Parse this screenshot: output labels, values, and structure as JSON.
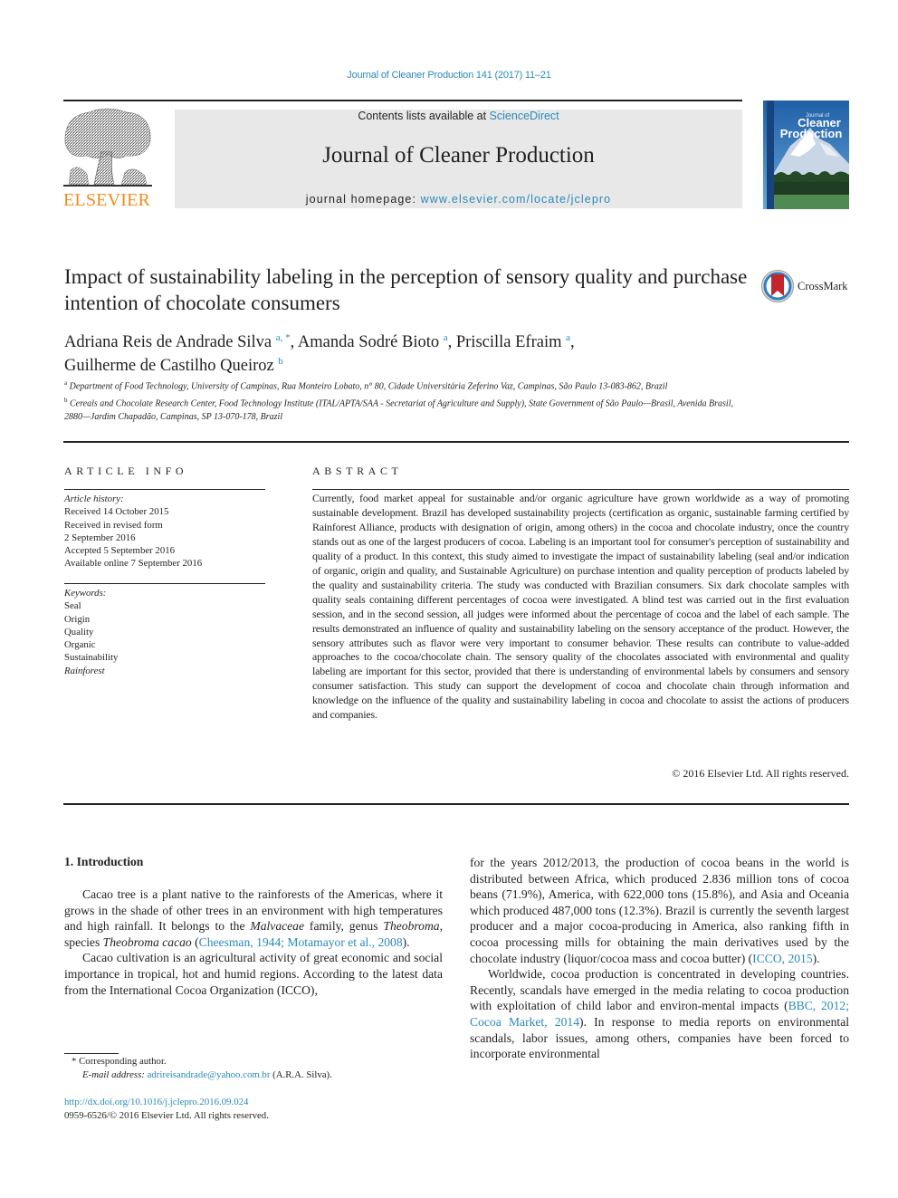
{
  "header": {
    "journal_ref": "Journal of Cleaner Production 141 (2017) 11–21",
    "contents_prefix": "Contents lists available at ",
    "contents_link": "ScienceDirect",
    "journal_title": "Journal of Cleaner Production",
    "homepage_prefix": "journal homepage: ",
    "homepage_link": "www.elsevier.com/locate/jclepro",
    "publisher_logo_text": "ELSEVIER",
    "cover": {
      "small_title": "Journal of",
      "line1": "Cleaner",
      "line2": "Production"
    },
    "colors": {
      "link": "#2a8ab8",
      "elsevier_orange": "#f28b1e",
      "masthead_bg": "#e8e8e8"
    }
  },
  "article": {
    "title": "Impact of sustainability labeling in the perception of sensory quality and purchase intention of chocolate consumers",
    "crossmark_label": "CrossMark",
    "authors": [
      {
        "name": "Adriana Reis de Andrade Silva",
        "sup": "a, *",
        "sep": ", "
      },
      {
        "name": "Amanda Sodré Bioto",
        "sup": "a",
        "sep": ", "
      },
      {
        "name": "Priscilla Efraim",
        "sup": "a",
        "sep": ","
      },
      {
        "name": "Guilherme de Castilho Queiroz",
        "sup": "b",
        "sep": ""
      }
    ],
    "affiliations": [
      {
        "mark": "a",
        "text": "Department of Food Technology, University of Campinas, Rua Monteiro Lobato, n° 80, Cidade Universitária Zeferino Vaz, Campinas, São Paulo 13-083-862, Brazil"
      },
      {
        "mark": "b",
        "text": "Cereals and Chocolate Research Center, Food Technology Institute (ITAL/APTA/SAA - Secretariat of Agriculture and Supply), State Government of São Paulo—Brasil, Avenida Brasil, 2880—Jardim Chapadão, Campinas, SP 13-070-178, Brazil"
      }
    ]
  },
  "article_info": {
    "heading": "ARTICLE INFO",
    "history_label": "Article history:",
    "history": [
      "Received 14 October 2015",
      "Received in revised form",
      "2 September 2016",
      "Accepted 5 September 2016",
      "Available online 7 September 2016"
    ],
    "keywords_label": "Keywords:",
    "keywords": [
      "Seal",
      "Origin",
      "Quality",
      "Organic",
      "Sustainability",
      "Rainforest"
    ]
  },
  "abstract": {
    "heading": "ABSTRACT",
    "text": "Currently, food market appeal for sustainable and/or organic agriculture have grown worldwide as a way of promoting sustainable development. Brazil has developed sustainability projects (certification as organic, sustainable farming certified by Rainforest Alliance, products with designation of origin, among others) in the cocoa and chocolate industry, once the country stands out as one of the largest producers of cocoa. Labeling is an important tool for consumer's perception of sustainability and quality of a product. In this context, this study aimed to investigate the impact of sustainability labeling (seal and/or indication of organic, origin and quality, and Sustainable Agriculture) on purchase intention and quality perception of products labeled by the quality and sustainability criteria. The study was conducted with Brazilian consumers. Six dark chocolate samples with quality seals containing different percentages of cocoa were investigated. A blind test was carried out in the first evaluation session, and in the second session, all judges were informed about the percentage of cocoa and the label of each sample. The results demonstrated an influence of quality and sustainability labeling on the sensory acceptance of the product. However, the sensory attributes such as flavor were very important to consumer behavior. These results can contribute to value-added approaches to the cocoa/chocolate chain. The sensory quality of the chocolates associated with environmental and quality labeling are important for this sector, provided that there is understanding of environmental labels by consumers and sensory consumer satisfaction. This study can support the development of cocoa and chocolate chain through information and knowledge on the influence of the quality and sustainability labeling in cocoa and chocolate to assist the actions of producers and companies.",
    "copyright": "© 2016 Elsevier Ltd. All rights reserved."
  },
  "body": {
    "section_heading": "1.  Introduction",
    "left": {
      "p1_a": "Cacao tree is a plant native to the rainforests of the Americas, where it grows in the shade of other trees in an environment with high temperatures and high rainfall. It belongs to the ",
      "p1_malvaceae": "Malvaceae",
      "p1_b": " family, genus ",
      "p1_theobroma": "Theobroma",
      "p1_c": ", species ",
      "p1_species": "Theobroma cacao",
      "p1_d": " (",
      "p1_cite": "Cheesman, 1944; Motamayor et al., 2008",
      "p1_e": ").",
      "p2": "Cacao cultivation is an agricultural activity of great economic and social importance in tropical, hot and humid regions. According to the latest data from the International Cocoa Organization (ICCO),"
    },
    "right": {
      "p1_a": "for the years 2012/2013, the production of cocoa beans in the world is distributed between Africa, which produced 2.836 million tons of cocoa beans (71.9%), America, with 622,000 tons (15.8%), and Asia and Oceania which produced 487,000 tons (12.3%). Brazil is currently the seventh largest producer and a major cocoa-producing in America, also ranking fifth in cocoa processing mills for obtaining the main derivatives used by the chocolate industry (liquor/cocoa mass and cocoa butter) (",
      "p1_cite": "ICCO, 2015",
      "p1_b": ").",
      "p2_a": "Worldwide, cocoa production is concentrated in developing countries. Recently, scandals have emerged in the media relating to cocoa production with exploitation of child labor and environ-mental impacts (",
      "p2_cite": "BBC, 2012; Cocoa Market, 2014",
      "p2_b": "). In response to media reports on environmental scandals, labor issues, among others, companies have been forced to incorporate environmental"
    }
  },
  "footnotes": {
    "corresponding": "* Corresponding author.",
    "email_label": "E-mail address: ",
    "email": "adrireisandrade@yahoo.com.br",
    "email_suffix": " (A.R.A. Silva).",
    "doi": "http://dx.doi.org/10.1016/j.jclepro.2016.09.024",
    "issn": "0959-6526/© 2016 Elsevier Ltd. All rights reserved."
  }
}
